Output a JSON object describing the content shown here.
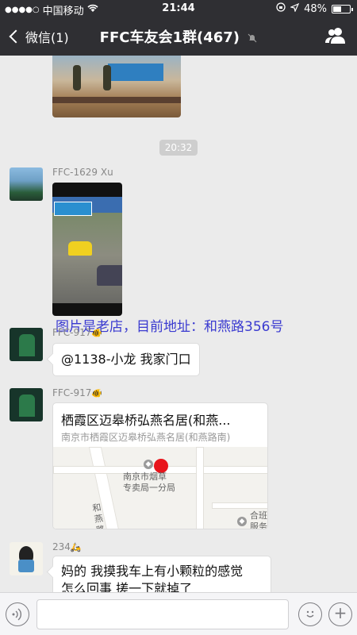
{
  "status_bar": {
    "carrier": "中国移动",
    "time": "21:44",
    "battery_percent": "48%",
    "battery_level": 0.48
  },
  "nav": {
    "back_label": "微信(1)",
    "title": "FFC车友会1群(467)"
  },
  "chat": {
    "timestamp": "20:32",
    "messages": [
      {
        "sender": "FFC-1629 Xu",
        "type": "image"
      },
      {
        "sender": "FFC-917",
        "sender_suffix": "🐠",
        "text": "@1138-小龙 我家门口"
      },
      {
        "sender": "FFC-917",
        "sender_suffix": "🐠",
        "type": "location",
        "location_title": "栖霞区迈皋桥弘燕名居(和燕...",
        "location_address": "南京市栖霞区迈皋桥弘燕名居(和燕路南)",
        "map_labels": {
          "poi_line1": "南京市烟草",
          "poi_line2": "专卖局一分局",
          "road": "和燕路",
          "poi2_line1": "合班",
          "poi2_line2": "服务"
        }
      },
      {
        "sender": "234",
        "sender_suffix": "🛵",
        "text_line1": "妈的 我摸我车上有小颗粒的感觉",
        "text_line2": "怎么回事 搓一下就掉了"
      }
    ],
    "overlay_caption": "图片是老店，目前地址：和燕路356号"
  },
  "colors": {
    "header_bg": "#2f2f33",
    "chat_bg": "#ebebeb",
    "overlay_text": "#3a3ad0"
  }
}
